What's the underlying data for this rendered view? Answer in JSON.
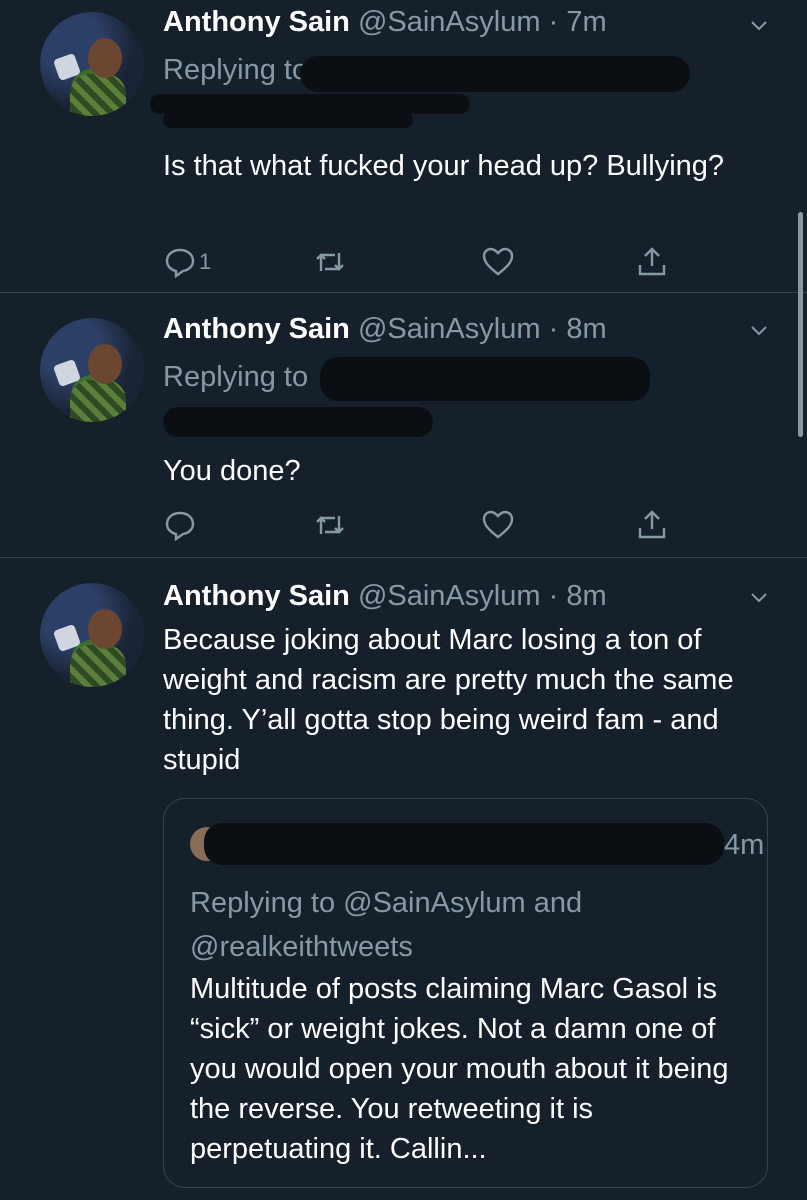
{
  "tweets": [
    {
      "name": "Anthony Sain",
      "handle": "@SainAsylum",
      "dot": "·",
      "time": "7m",
      "replying_prefix": "Replying to",
      "text": "Is that what fucked your head up? Bullying?",
      "reply_count": "1"
    },
    {
      "name": "Anthony Sain",
      "handle": "@SainAsylum",
      "dot": "·",
      "time": "8m",
      "replying_prefix": "Replying to",
      "text": "You done?",
      "reply_count": ""
    },
    {
      "name": "Anthony Sain",
      "handle": "@SainAsylum",
      "dot": "·",
      "time": "8m",
      "text": "Because joking about Marc losing a ton of weight and racism are pretty much the same thing. Y’all gotta stop being weird fam - and stupid",
      "quote": {
        "time": "4m",
        "replying": "Replying to @SainAsylum and @realkeithtweets",
        "text": "Multitude of posts claiming Marc Gasol is “sick” or weight jokes. Not a damn one of you would open your mouth about it being the reverse. You retweeting it is perpetuating it. Callin..."
      }
    }
  ],
  "colors": {
    "background": "#15202b",
    "secondary_text": "#8899a6",
    "divider": "#38444d"
  },
  "icons": [
    "reply-icon",
    "retweet-icon",
    "like-icon",
    "share-icon",
    "chevron-down-icon"
  ]
}
